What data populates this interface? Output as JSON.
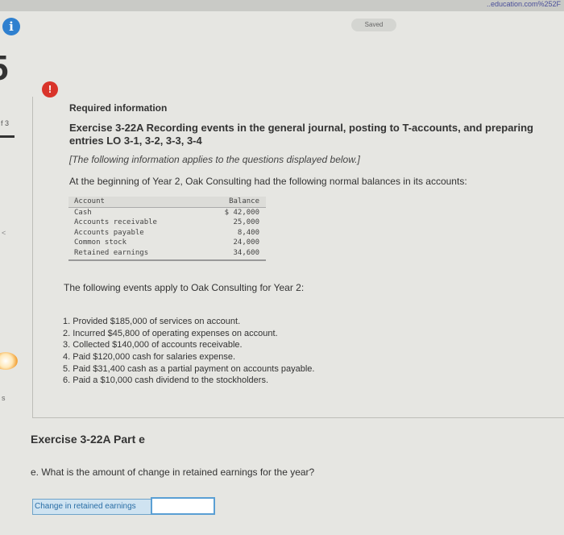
{
  "browser": {
    "url_fragment": "..education.com%252F",
    "status_pill": "Saved"
  },
  "sidebar": {
    "page_number": "f 3",
    "bottom_letter": "s"
  },
  "header": {
    "required_label": "Required information",
    "exercise_title": "Exercise 3-22A Recording events in the general journal, posting to T-accounts, and preparing",
    "exercise_title_line2": "entries LO 3-1, 3-2, 3-3, 3-4",
    "note": "[The following information applies to the questions displayed below.]",
    "intro": "At the beginning of Year 2, Oak Consulting had the following normal balances in its accounts:"
  },
  "balances": {
    "columns": [
      "Account",
      "Balance"
    ],
    "rows": [
      {
        "account": "Cash",
        "balance": "$ 42,000"
      },
      {
        "account": "Accounts receivable",
        "balance": "25,000"
      },
      {
        "account": "Accounts payable",
        "balance": "8,400"
      },
      {
        "account": "Common stock",
        "balance": "24,000"
      },
      {
        "account": "Retained earnings",
        "balance": "34,600"
      }
    ]
  },
  "events": {
    "intro": "The following events apply to Oak Consulting for Year 2:",
    "items": [
      "1. Provided $185,000 of services on account.",
      "2. Incurred $45,800 of operating expenses on account.",
      "3. Collected $140,000 of accounts receivable.",
      "4. Paid $120,000 cash for salaries expense.",
      "5. Paid $31,400 cash as a partial payment on accounts payable.",
      "6. Paid a $10,000 cash dividend to the stockholders."
    ]
  },
  "part": {
    "title": "Exercise 3-22A Part e",
    "question": "e. What is the amount of change in retained earnings for the year?",
    "answer_label": "Change in retained earnings",
    "answer_value": ""
  },
  "icons": {
    "info": "info-icon",
    "warning": "warning-icon"
  },
  "colors": {
    "info_blue": "#2f80cf",
    "warning_red": "#d9342a",
    "input_border": "#5a9fd4"
  }
}
